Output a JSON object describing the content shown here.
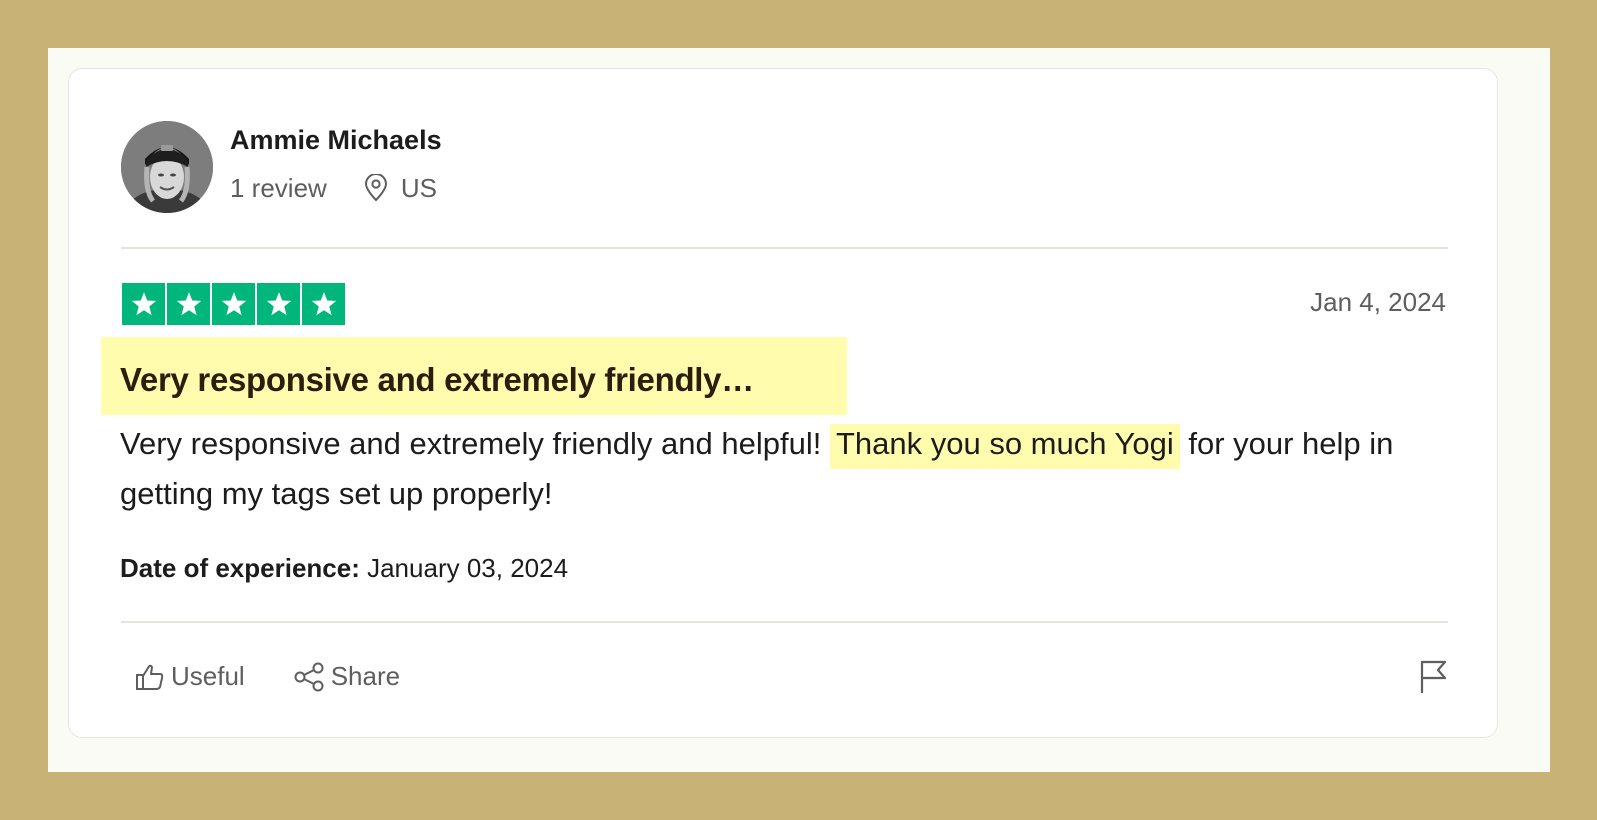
{
  "reviewer": {
    "name": "Ammie Michaels",
    "review_count": "1 review",
    "country": "US"
  },
  "review": {
    "rating": 5,
    "date": "Jan 4, 2024",
    "title": "Very responsive and extremely friendly…",
    "body_before": "Very responsive and extremely friendly and helpful! ",
    "body_highlight": "Thank you so much Yogi",
    "body_after": " for your help in getting my tags set up properly!",
    "experience_label": "Date of experience:",
    "experience_date": " January 03, 2024"
  },
  "actions": {
    "useful_label": "Useful",
    "share_label": "Share"
  },
  "icons": {
    "location": "map-pin-icon",
    "useful": "thumbs-up-icon",
    "share": "share-icon",
    "report": "flag-icon",
    "star": "star-icon"
  },
  "colors": {
    "star_green": "#00b67a",
    "highlight": "#fffcae",
    "frame_gold": "#c8b276"
  }
}
